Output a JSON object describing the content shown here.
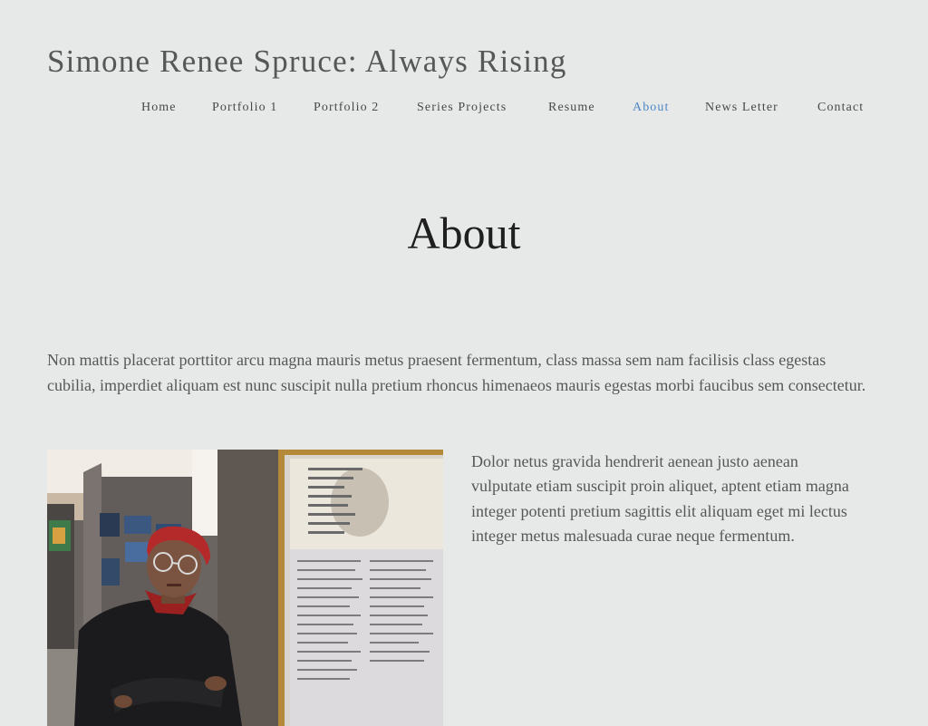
{
  "site": {
    "title": "Simone Renee Spruce: Always Rising"
  },
  "nav": {
    "items": [
      {
        "label": "Home",
        "active": false
      },
      {
        "label": "Portfolio 1",
        "active": false
      },
      {
        "label": "Portfolio 2",
        "active": false
      },
      {
        "label": "Series Projects",
        "active": false
      },
      {
        "label": "Resume",
        "active": false
      },
      {
        "label": "About",
        "active": true
      },
      {
        "label": "News Letter",
        "active": false
      },
      {
        "label": "Contact",
        "active": false
      }
    ],
    "active_color": "#4f86c6"
  },
  "main": {
    "heading": "About",
    "intro": "Non mattis placerat porttitor arcu magna mauris metus praesent fermentum, class massa sem nam facilisis class egestas cubilia, imperdiet aliquam est nunc suscipit nulla pretium rhoncus himenaeos mauris egestas morbi faucibus sem consectetur.",
    "side_text": "Dolor netus gravida hendrerit aenean justo aenean vulputate etiam suscipit proin aliquet, aptent etiam magna integer potenti pretium sagittis elit aliquam eget mi lectus integer metus malesuada curae neque fermentum."
  },
  "colors": {
    "background": "#e6e9e8",
    "text": "#555857",
    "heading": "#1f1f1f"
  }
}
